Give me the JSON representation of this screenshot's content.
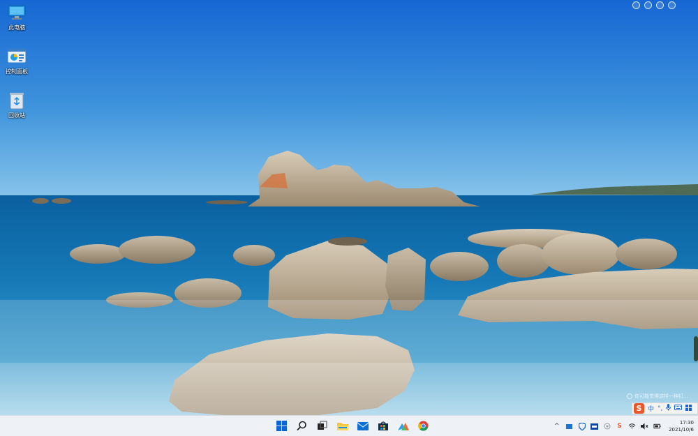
{
  "desktop_icons": [
    {
      "label": "此电脑",
      "icon": "this-pc-icon"
    },
    {
      "label": "控制面板",
      "icon": "control-panel-icon"
    },
    {
      "label": "回收站",
      "icon": "recycle-bin-icon"
    }
  ],
  "notification_hint": "你可能觉得这样一种钉...",
  "ime": {
    "logo_text": "S",
    "mode_label": "中",
    "punct_label": "°,"
  },
  "taskbar": {
    "pinned": [
      {
        "name": "start-button",
        "icon": "windows-start-icon"
      },
      {
        "name": "search-button",
        "icon": "search-icon"
      },
      {
        "name": "task-view-button",
        "icon": "task-view-icon"
      },
      {
        "name": "file-explorer-button",
        "icon": "folder-icon"
      },
      {
        "name": "mail-button",
        "icon": "mail-icon"
      },
      {
        "name": "store-button",
        "icon": "store-icon"
      },
      {
        "name": "photos-button",
        "icon": "photos-icon"
      },
      {
        "name": "chrome-button",
        "icon": "chrome-icon"
      }
    ]
  },
  "tray": {
    "overflow_glyph": "^",
    "ime_tray_label": "S",
    "time": "17:30",
    "date": "2021/10/6"
  },
  "colors": {
    "taskbar_bg": "#eef1f5",
    "accent_blue": "#0a64d6",
    "ime_orange": "#e8562a"
  }
}
